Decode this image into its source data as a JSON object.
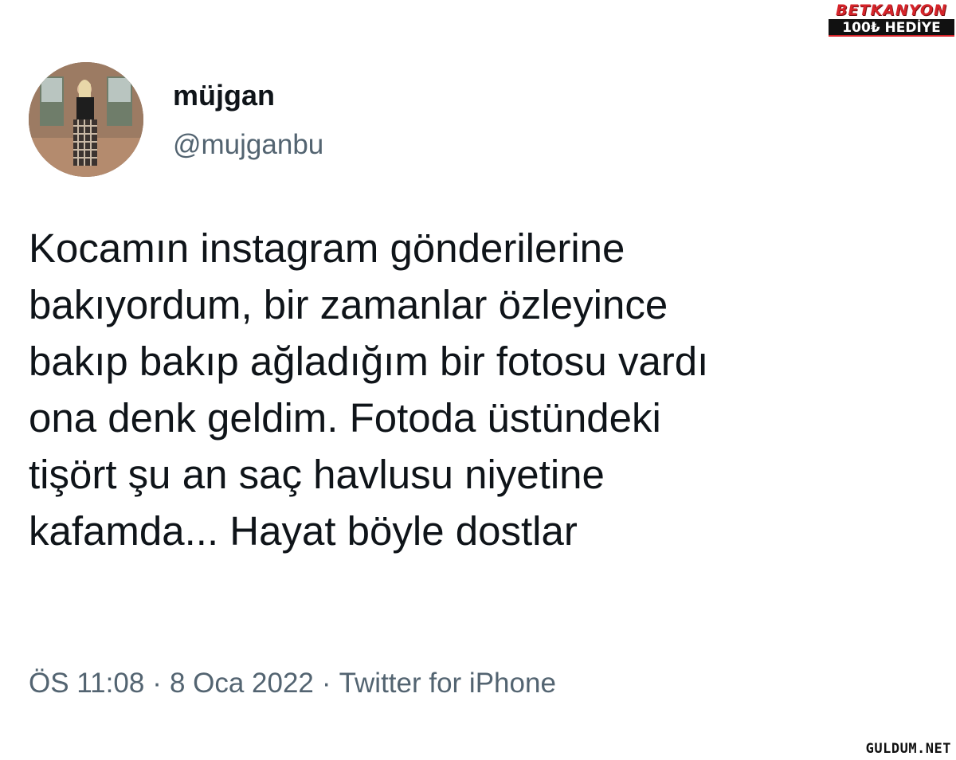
{
  "ad": {
    "brand": "BETKANYON",
    "promo": "100₺ HEDİYE",
    "colors": {
      "brand_red": "#d6242a",
      "dark": "#111111"
    }
  },
  "tweet": {
    "author": {
      "display_name": "müjgan",
      "handle": "@mujganbu",
      "avatar_icon": "profile-photo"
    },
    "text_lines": [
      "Kocamın instagram gönderilerine",
      "bakıyordum, bir zamanlar özleyince",
      "bakıp bakıp ağladığım bir fotosu vardı",
      "ona denk geldim. Fotoda üstündeki",
      "tişört şu an saç havlusu niyetine",
      "kafamda... Hayat böyle dostlar"
    ],
    "meta": {
      "time": "ÖS 11:08",
      "date": "8 Oca 2022",
      "source": "Twitter for iPhone",
      "separator": "·"
    }
  },
  "watermark": "GULDUM.NET",
  "colors": {
    "text": "#0f1419",
    "secondary": "#536471",
    "background": "#ffffff"
  }
}
